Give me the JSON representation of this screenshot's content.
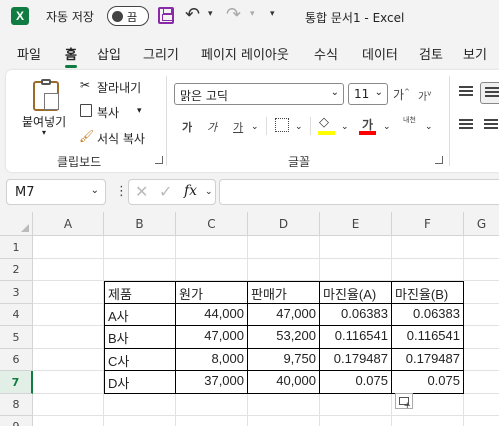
{
  "titlebar": {
    "app_logo": "X",
    "autosave_label": "자동 저장",
    "autosave_state": "끔",
    "doc_title": "통합 문서1  -  Excel",
    "icons": [
      "save-icon",
      "undo-icon",
      "redo-icon",
      "customize-qat-icon"
    ]
  },
  "menu": {
    "tabs": [
      "파일",
      "홈",
      "삽입",
      "그리기",
      "페이지 레이아웃",
      "수식",
      "데이터",
      "검토",
      "보기"
    ],
    "active": "홈"
  },
  "ribbon": {
    "clipboard": {
      "paste_label": "붙여넣기",
      "cut_label": "잘라내기",
      "copy_label": "복사",
      "format_painter_label": "서식 복사",
      "group_label": "클립보드"
    },
    "font": {
      "font_name": "맑은 고딕",
      "font_size": "11",
      "grow_label": "가",
      "shrink_label": "가",
      "bold_label": "가",
      "italic_label": "가",
      "underline_label": "가",
      "fontcolor_label": "가",
      "phonetic_label": "내천",
      "group_label": "글꼴",
      "accent_yellow": "#ffff00",
      "accent_red": "#ff0000"
    }
  },
  "formula_bar": {
    "name_box": "M7",
    "fx_label": "fx",
    "formula": ""
  },
  "sheet": {
    "columns": [
      "A",
      "B",
      "C",
      "D",
      "E",
      "F",
      "G"
    ],
    "rows": [
      "1",
      "2",
      "3",
      "4",
      "5",
      "6",
      "7",
      "8",
      "9"
    ],
    "selected_row": "7",
    "table": {
      "headers": [
        "제품",
        "원가",
        "판매가",
        "마진율(A)",
        "마진율(B)"
      ],
      "rows": [
        [
          "A사",
          "44,000",
          "47,000",
          "0.06383",
          "0.06383"
        ],
        [
          "B사",
          "47,000",
          "53,200",
          "0.116541",
          "0.116541"
        ],
        [
          "C사",
          "8,000",
          "9,750",
          "0.179487",
          "0.179487"
        ],
        [
          "D사",
          "37,000",
          "40,000",
          "0.075",
          "0.075"
        ]
      ]
    }
  },
  "colors": {
    "excel_green": "#107c41",
    "save_purple": "#8b2aa8"
  }
}
